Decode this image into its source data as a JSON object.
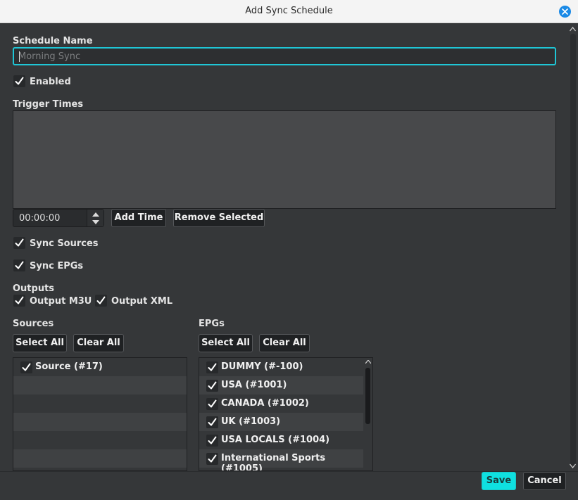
{
  "window": {
    "title": "Add Sync Schedule"
  },
  "form": {
    "schedule_name_label": "Schedule Name",
    "schedule_name_placeholder": "Morning Sync",
    "schedule_name_value": "",
    "enabled_label": "Enabled",
    "enabled_checked": true,
    "trigger_times_label": "Trigger Times",
    "trigger_times": [],
    "time_value": "00:00:00",
    "add_time_label": "Add Time",
    "remove_selected_label": "Remove Selected",
    "sync_sources_label": "Sync Sources",
    "sync_sources_checked": true,
    "sync_epgs_label": "Sync EPGs",
    "sync_epgs_checked": true,
    "outputs_label": "Outputs",
    "output_m3u_label": "Output M3U",
    "output_m3u_checked": true,
    "output_xml_label": "Output XML",
    "output_xml_checked": true
  },
  "sources": {
    "label": "Sources",
    "select_all_label": "Select All",
    "clear_all_label": "Clear All",
    "items": [
      {
        "label": "Source (#17)",
        "checked": true
      }
    ]
  },
  "epgs": {
    "label": "EPGs",
    "select_all_label": "Select All",
    "clear_all_label": "Clear All",
    "items": [
      {
        "label": "DUMMY (#-100)",
        "checked": true
      },
      {
        "label": "USA (#1001)",
        "checked": true
      },
      {
        "label": "CANADA (#1002)",
        "checked": true
      },
      {
        "label": "UK (#1003)",
        "checked": true
      },
      {
        "label": "USA LOCALS (#1004)",
        "checked": true
      },
      {
        "label": "International Sports (#1005)",
        "checked": true
      }
    ]
  },
  "footer": {
    "save_label": "Save",
    "cancel_label": "Cancel"
  },
  "colors": {
    "accent": "#0fe0e0",
    "focus_border": "#1fc6d6",
    "close_button": "#1b8ae6",
    "background": "#353739"
  }
}
